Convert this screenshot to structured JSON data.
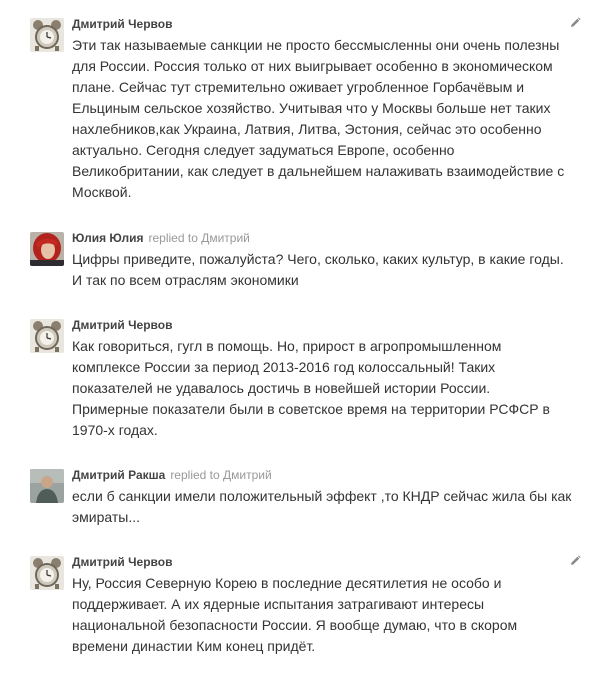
{
  "comments": [
    {
      "author": "Дмитрий Червов",
      "reply_to": "",
      "avatar": "alarm-clock-avatar",
      "editable": true,
      "lines": [
        "Эти так называемые санкции не просто бессмысленны они очень полезны",
        "для России. Россия только от них выигрывает особенно в экономическом",
        "плане. Сейчас тут стремительно оживает угробленное Горбачёвым и",
        "Ельциным сельское хозяйство. Учитывая что у Москвы больше нет таких",
        "нахлебников,как Украина, Латвия, Литва, Эстония, сейчас это особенно",
        "актуально. Сегодня следует задуматься Европе, особенно",
        "Великобритании, как следует в дальнейшем налаживать взаимодействие с",
        "Москвой."
      ]
    },
    {
      "author": "Юлия Юлия",
      "reply_to": "replied to Дмитрий",
      "avatar": "red-hair-woman-avatar",
      "editable": false,
      "lines": [
        "Цифры приведите, пожалуйста? Чего, сколько, каких культур, в какие годы.",
        "И так по всем отраслям экономики"
      ]
    },
    {
      "author": "Дмитрий Червов",
      "reply_to": "",
      "avatar": "alarm-clock-avatar",
      "editable": false,
      "lines": [
        "Как говориться, гугл в помощь. Но, прирост в агропромышленном",
        "комплексе России за период 2013-2016 год колоссальный! Таких",
        "показателей не удавалось достичь в новейшей истории России.",
        "Примерные показатели были в советское время на территории РСФСР в",
        "1970-х годах."
      ]
    },
    {
      "author": "Дмитрий Ракша",
      "reply_to": "replied to Дмитрий",
      "avatar": "man-photo-avatar",
      "editable": false,
      "lines": [
        "если б санкции имели положительный эффект ,то КНДР сейчас жила бы как",
        "эмираты..."
      ]
    },
    {
      "author": "Дмитрий Червов",
      "reply_to": "",
      "avatar": "alarm-clock-avatar",
      "editable": true,
      "lines": [
        "Ну, Россия Северную Корею в последние десятилетия не особо и",
        "поддерживает. А их ядерные испытания затрагивают интересы",
        "национальной безопасности России. Я вообще думаю, что в скором",
        "времени династии Ким конец придёт."
      ]
    }
  ],
  "colors": {
    "author": "#444444",
    "reply_to": "#999999",
    "text": "#333333",
    "icon": "#888888"
  }
}
